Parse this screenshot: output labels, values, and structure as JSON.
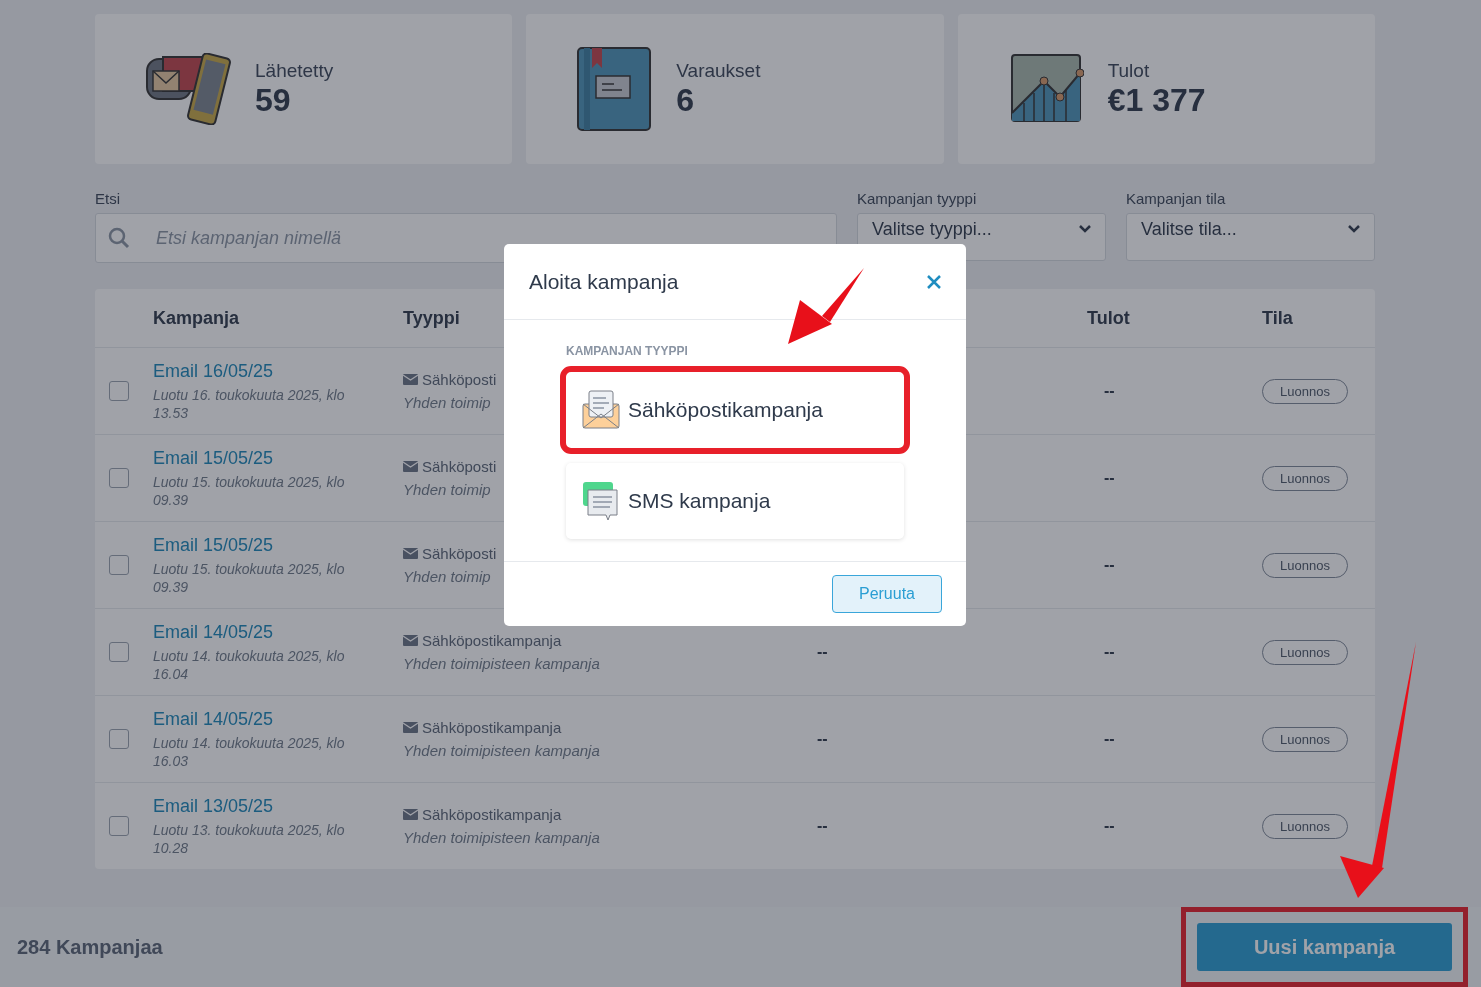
{
  "stats": [
    {
      "kind": "mail",
      "label": "Lähetetty",
      "value": "59"
    },
    {
      "kind": "book",
      "label": "Varaukset",
      "value": "6"
    },
    {
      "kind": "chart",
      "label": "Tulot",
      "value": "€1 377"
    }
  ],
  "filters": {
    "search": {
      "label": "Etsi",
      "placeholder": "Etsi kampanjan nimellä"
    },
    "selects": [
      {
        "label": "Kampanjan tyyppi",
        "value": "Valitse tyyppi..."
      },
      {
        "label": "Kampanjan tila",
        "value": "Valitse tila..."
      }
    ]
  },
  "table": {
    "columns": [
      "Kampanja",
      "Tyyppi",
      "Tulot",
      "Tila"
    ],
    "rows": [
      {
        "name": "Email 16/05/25",
        "created": "Luotu 16. toukokuuta 2025, klo 13.53",
        "type": "Sähköposti",
        "scope": "Yhden toimip",
        "revenue": "--",
        "status": "Luonnos",
        "checked": false
      },
      {
        "name": "Email 15/05/25",
        "created": "Luotu 15. toukokuuta 2025, klo 09.39",
        "type": "Sähköposti",
        "scope": "Yhden toimip",
        "revenue": "--",
        "status": "Luonnos",
        "checked": false
      },
      {
        "name": "Email 15/05/25",
        "created": "Luotu 15. toukokuuta 2025, klo 09.39",
        "type": "Sähköposti",
        "scope": "Yhden toimip",
        "revenue": "--",
        "status": "Luonnos",
        "checked": false
      },
      {
        "name": "Email 14/05/25",
        "created": "Luotu 14. toukokuuta 2025, klo 16.04",
        "type": "Sähköpostikampanja",
        "scope": "Yhden toimipisteen kampanja",
        "column_3": "--",
        "revenue": "--",
        "status": "Luonnos",
        "checked": false
      },
      {
        "name": "Email 14/05/25",
        "created": "Luotu 14. toukokuuta 2025, klo 16.03",
        "type": "Sähköpostikampanja",
        "scope": "Yhden toimipisteen kampanja",
        "column_3": "--",
        "revenue": "--",
        "status": "Luonnos",
        "checked": false
      },
      {
        "name": "Email 13/05/25",
        "created": "Luotu 13. toukokuuta 2025, klo 10.28",
        "type": "Sähköpostikampanja",
        "scope": "Yhden toimipisteen kampanja",
        "column_3": "--",
        "revenue": "--",
        "status": "Luonnos",
        "checked": false
      }
    ]
  },
  "footer": {
    "count": "284 Kampanjaa",
    "new_button": {
      "label": "Uusi kampanja",
      "highlighted": true
    }
  },
  "modal": {
    "title": "Aloita kampanja",
    "section_label": "KAMPANJAN TYYPPI",
    "options": [
      {
        "kind": "email",
        "label": "Sähköpostikampanja",
        "highlighted": true
      },
      {
        "kind": "sms",
        "label": "SMS kampanja",
        "highlighted": false
      }
    ],
    "cancel": "Peruuta"
  }
}
